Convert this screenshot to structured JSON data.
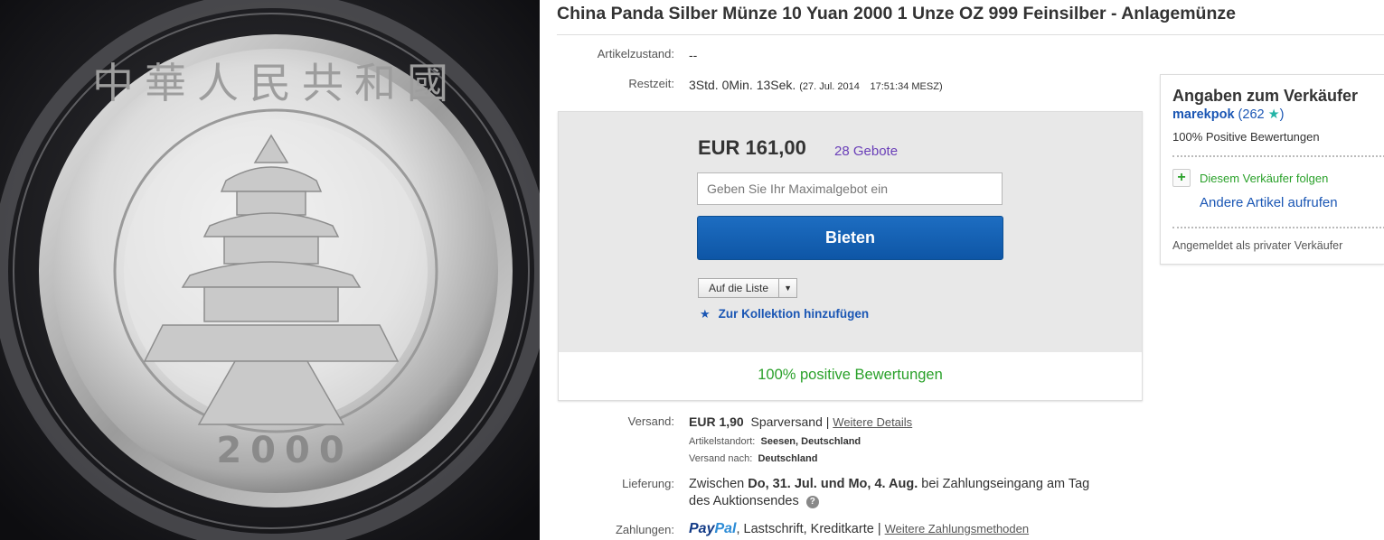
{
  "product_image": {
    "rim_characters": "中華人民共和國",
    "year": "2000"
  },
  "listing": {
    "title": "China Panda Silber Münze 10 Yuan 2000 1 Unze OZ 999 Feinsilber - Anlagemünze",
    "condition_label": "Artikelzustand:",
    "condition_value": "--",
    "time_label": "Restzeit:",
    "time_value": "3Std. 0Min. 13Sek.",
    "end_date": "(27. Jul. 2014",
    "end_time": "17:51:34 MESZ)"
  },
  "bid": {
    "price": "EUR 161,00",
    "bids_count": "28 Gebote",
    "input_placeholder": "Geben Sie Ihr Maximalgebot ein",
    "bid_button": "Bieten",
    "watch_button": "Auf die Liste",
    "collection_link": "Zur Kollektion hinzufügen",
    "positive_feedback": "100% positive Bewertungen"
  },
  "shipping": {
    "label": "Versand:",
    "price": "EUR 1,90",
    "method": "Sparversand |",
    "details_link": "Weitere Details",
    "location_label": "Artikelstandort:",
    "location_value": "Seesen, Deutschland",
    "ships_to_label": "Versand nach:",
    "ships_to_value": "Deutschland"
  },
  "delivery": {
    "label": "Lieferung:",
    "prefix": "Zwischen",
    "range": "Do, 31. Jul. und Mo, 4. Aug.",
    "suffix": "bei Zahlungseingang am Tag",
    "line2": "des Auktionsendes",
    "help_icon": "?"
  },
  "payments": {
    "label": "Zahlungen:",
    "paypal_part1": "Pay",
    "paypal_part2": "Pal",
    "methods": ", Lastschrift,  Kreditkarte  |",
    "more_link": "Weitere Zahlungsmethoden"
  },
  "seller": {
    "heading": "Angaben zum Verkäufer",
    "username": "marekpok",
    "score_open": "(262",
    "score_star": "★",
    "score_close": ")",
    "positive": "100% Positive Bewertungen",
    "follow": "Diesem Verkäufer folgen",
    "other_items": "Andere Artikel aufrufen",
    "account_type": "Angemeldet als privater Verkäufer"
  },
  "colors": {
    "bid_button": "#0e56a6",
    "link": "#1a56b4",
    "positive": "#2aa12a",
    "bids": "#6a3fb8"
  },
  "icons": {
    "collection": "star-icon",
    "follow": "plus-icon",
    "watch_caret": "chevron-down-icon",
    "delivery_help": "question-icon"
  }
}
